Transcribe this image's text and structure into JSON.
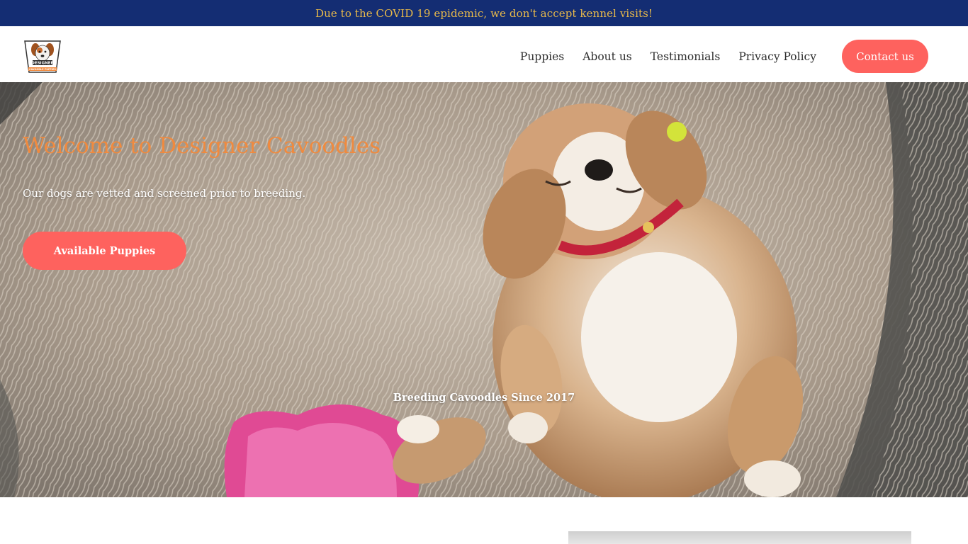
{
  "banner": {
    "text": "Due to the COVID 19 epidemic, we don't accept kennel visits!"
  },
  "header": {
    "logo": {
      "icon": "dog-logo-icon",
      "text": "DESIGNER",
      "subtext": "CAVOODLE PUPPIES"
    },
    "nav": [
      {
        "label": "Puppies"
      },
      {
        "label": "About us"
      },
      {
        "label": "Testimonials"
      },
      {
        "label": "Privacy Policy"
      }
    ],
    "contact_label": "Contact us"
  },
  "hero": {
    "title": "Welcome to Designer Cavoodles",
    "subtitle": "Our dogs are vetted and screened prior to breeding.",
    "button_label": "Available Puppies",
    "tagline": "Breeding Cavoodles Since 2017",
    "image": "sleeping-puppy-on-rug-image"
  },
  "colors": {
    "banner_bg": "#142d73",
    "banner_text": "#e8b94a",
    "accent": "#fe625e",
    "title": "#f08a3e"
  }
}
